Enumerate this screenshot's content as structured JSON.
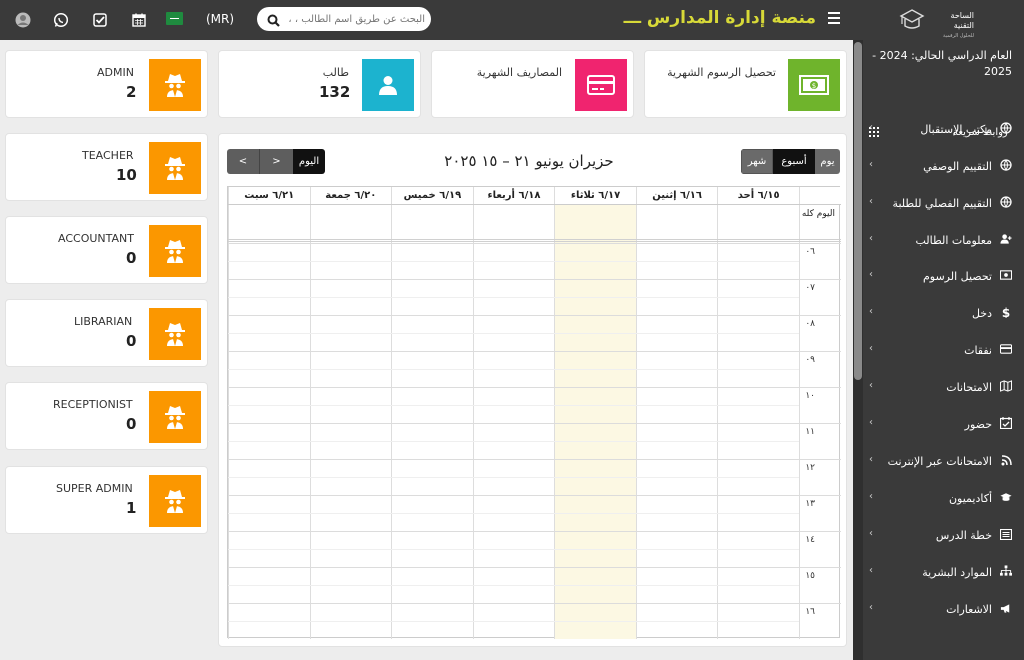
{
  "topbar": {
    "lang_label": "(MR)",
    "search_placeholder": "البحث عن طريق اسم الطالب ، ،",
    "app_title": "منصة إدارة المدارس ـــ",
    "logo_title": "الساحة التقنية",
    "logo_subtitle": "للحلول الرقمية"
  },
  "sidebar": {
    "year_label": "العام الدراسي الحالي: 2024 - 2025",
    "quick_links": "روابط سريعة",
    "items": [
      {
        "label": "مكتب الإستقبال",
        "icon": "globe-icon"
      },
      {
        "label": "التقييم الوصفي",
        "icon": "globe-icon"
      },
      {
        "label": "التقييم الفصلي للطلبة",
        "icon": "globe-icon"
      },
      {
        "label": "معلومات الطالب",
        "icon": "user-plus-icon"
      },
      {
        "label": "تحصيل الرسوم",
        "icon": "money-icon"
      },
      {
        "label": "دخل",
        "icon": "dollar-icon"
      },
      {
        "label": "نفقات",
        "icon": "credit-card-icon"
      },
      {
        "label": "الامتحانات",
        "icon": "map-icon"
      },
      {
        "label": "حضور",
        "icon": "calendar-check-icon"
      },
      {
        "label": "الامتحانات عبر الإنترنت",
        "icon": "rss-icon"
      },
      {
        "label": "أكاديميون",
        "icon": "graduation-cap-icon"
      },
      {
        "label": "خطة الدرس",
        "icon": "list-icon"
      },
      {
        "label": "الموارد البشرية",
        "icon": "sitemap-icon"
      },
      {
        "label": "الاشعارات",
        "icon": "bullhorn-icon"
      }
    ]
  },
  "stats": {
    "admin": {
      "title": "ADMIN",
      "count": "2"
    },
    "student": {
      "title": "طالب",
      "count": "132"
    },
    "monthly_expenses": {
      "title": "المصاريف الشهرية"
    },
    "monthly_fees": {
      "title": "تحصيل الرسوم الشهرية"
    },
    "teacher": {
      "title": "TEACHER",
      "count": "10"
    },
    "accountant": {
      "title": "ACCOUNTANT",
      "count": "0"
    },
    "librarian": {
      "title": "LIBRARIAN",
      "count": "0"
    },
    "receptionist": {
      "title": "RECEPTIONIST",
      "count": "0"
    },
    "super_admin": {
      "title": "SUPER ADMIN",
      "count": "1"
    }
  },
  "calendar": {
    "title": "حزيران يونيو ٢١ – ١٥ ٢٠٢٥",
    "today_label": "اليوم",
    "prev_label": "<",
    "next_label": ">",
    "view_day": "يوم",
    "view_week": "أسبوع",
    "view_month": "شهر",
    "allday_label": "اليوم كله",
    "days": [
      "٦/١٥ أحد",
      "٦/١٦ إثنين",
      "٦/١٧ ثلاثاء",
      "٦/١٨ أربعاء",
      "٦/١٩ خميس",
      "٦/٢٠ جمعة",
      "٦/٢١ سبت"
    ],
    "hours": [
      "٠٦",
      "٠٧",
      "٠٨",
      "٠٩",
      "١٠",
      "١١",
      "١٢",
      "١٣",
      "١٤",
      "١٥",
      "١٦"
    ]
  },
  "colors": {
    "orange": "#fb9700",
    "cyan": "#1cb3cf",
    "pink": "#f0246f",
    "green": "#6fb42c",
    "dark": "#3a3a3a",
    "today_bg": "#fcf8e3"
  }
}
